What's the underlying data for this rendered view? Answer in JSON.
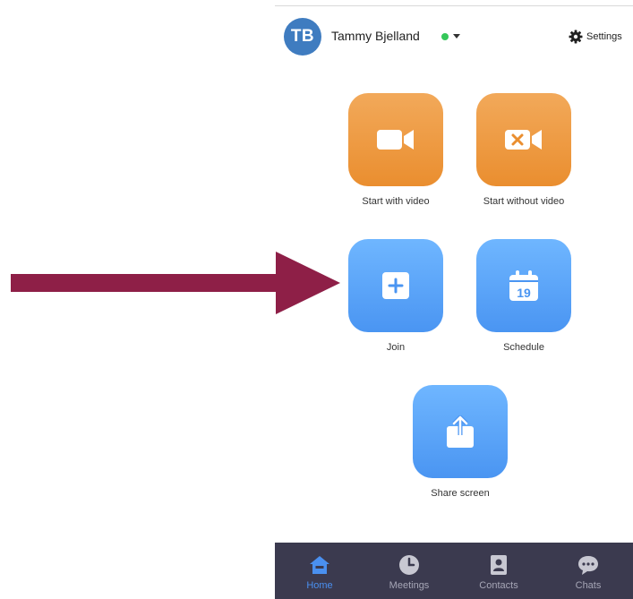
{
  "user": {
    "initials": "TB",
    "name": "Tammy Bjelland",
    "status_color": "#35c759"
  },
  "header": {
    "settings_label": "Settings",
    "settings_icon": "gear-icon"
  },
  "actions": [
    {
      "label": "Start with video",
      "icon": "video-camera-icon",
      "color": "#ee9b45"
    },
    {
      "label": "Start without video",
      "icon": "video-off-icon",
      "color": "#ee9b45"
    },
    {
      "label": "Join",
      "icon": "plus-icon",
      "color": "#5aa6fb"
    },
    {
      "label": "Schedule",
      "icon": "calendar-icon",
      "date": "19",
      "color": "#5aa6fb"
    },
    {
      "label": "Share screen",
      "icon": "share-upload-icon",
      "color": "#5aa6fb"
    }
  ],
  "annotation": {
    "type": "arrow",
    "color": "#8e1f47"
  },
  "bottom_nav": {
    "items": [
      {
        "label": "Home",
        "icon": "home-icon",
        "active": true
      },
      {
        "label": "Meetings",
        "icon": "clock-icon",
        "active": false
      },
      {
        "label": "Contacts",
        "icon": "contact-book-icon",
        "active": false
      },
      {
        "label": "Chats",
        "icon": "chat-bubble-icon",
        "active": false
      }
    ],
    "background": "#3b3a4f",
    "active_color": "#4a90f0"
  }
}
